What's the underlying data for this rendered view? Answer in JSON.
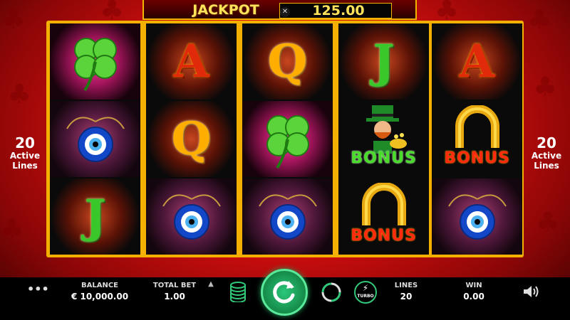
{
  "jackpot": {
    "label": "JACKPOT",
    "value": "125.00",
    "close_icon": "close-icon"
  },
  "reels": [
    [
      {
        "symbol": "clover",
        "glow": "pink"
      },
      {
        "symbol": "evil-eye",
        "glow": "purple"
      },
      {
        "symbol": "J",
        "glow": "orange"
      }
    ],
    [
      {
        "symbol": "A",
        "glow": "orange"
      },
      {
        "symbol": "Q",
        "glow": "orange"
      },
      {
        "symbol": "evil-eye",
        "glow": "purple"
      }
    ],
    [
      {
        "symbol": "Q",
        "glow": "orange"
      },
      {
        "symbol": "clover",
        "glow": "pink"
      },
      {
        "symbol": "evil-eye",
        "glow": "purple"
      }
    ],
    [
      {
        "symbol": "J",
        "glow": "orange"
      },
      {
        "symbol": "leprechaun-bonus",
        "glow": "none",
        "label": "BONUS"
      },
      {
        "symbol": "horseshoe-bonus",
        "glow": "none",
        "label": "BONUS"
      }
    ],
    [
      {
        "symbol": "A",
        "glow": "orange"
      },
      {
        "symbol": "horseshoe-bonus",
        "glow": "none",
        "label": "BONUS"
      },
      {
        "symbol": "evil-eye",
        "glow": "purple"
      }
    ]
  ],
  "lines_left": {
    "count": "20",
    "label1": "Active",
    "label2": "Lines"
  },
  "lines_right": {
    "count": "20",
    "label1": "Active",
    "label2": "Lines"
  },
  "bottom": {
    "menu_icon": "ellipsis-icon",
    "balance_label": "BALANCE",
    "balance_value": "€ 10,000.00",
    "total_bet_label": "TOTAL BET",
    "total_bet_value": "1.00",
    "bet_up_icon": "chevron-up-icon",
    "coins_icon": "coin-stack-icon",
    "spin_icon": "spin-arrow-icon",
    "autoplay_icon": "autoplay-icon",
    "turbo_label": "TURBO",
    "lines_label": "LINES",
    "lines_value": "20",
    "win_label": "WIN",
    "win_value": "0.00",
    "sound_icon": "speaker-icon"
  },
  "colors": {
    "frame": "#f4b000",
    "background": "#d80f0f",
    "spin_button": "#1fa05a",
    "text_gold": "#ffe35a"
  }
}
